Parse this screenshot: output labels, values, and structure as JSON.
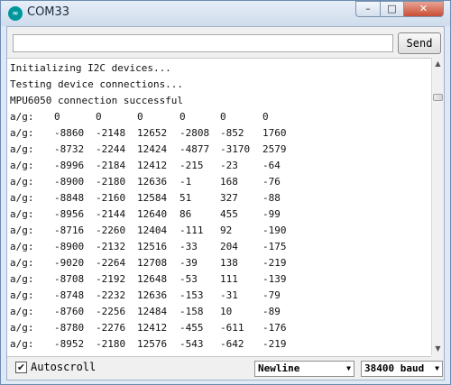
{
  "window": {
    "title": "COM33",
    "icon": "arduino-icon",
    "controls": {
      "minimize": "–",
      "maximize": "□",
      "close": "✕"
    }
  },
  "input": {
    "value": "",
    "placeholder": ""
  },
  "send_label": "Send",
  "output": {
    "messages": [
      "Initializing I2C devices...",
      "Testing device connections...",
      "MPU6050 connection successful"
    ],
    "rows": [
      {
        "label": "a/g:",
        "values": [
          "0",
          "0",
          "0",
          "0",
          "0",
          "0"
        ]
      },
      {
        "label": "a/g:",
        "values": [
          "-8860",
          "-2148",
          "12652",
          "-2808",
          "-852",
          "1760"
        ]
      },
      {
        "label": "a/g:",
        "values": [
          "-8732",
          "-2244",
          "12424",
          "-4877",
          "-3170",
          "2579"
        ]
      },
      {
        "label": "a/g:",
        "values": [
          "-8996",
          "-2184",
          "12412",
          "-215",
          "-23",
          "-64"
        ]
      },
      {
        "label": "a/g:",
        "values": [
          "-8900",
          "-2180",
          "12636",
          "-1",
          "168",
          "-76"
        ]
      },
      {
        "label": "a/g:",
        "values": [
          "-8848",
          "-2160",
          "12584",
          "51",
          "327",
          "-88"
        ]
      },
      {
        "label": "a/g:",
        "values": [
          "-8956",
          "-2144",
          "12640",
          "86",
          "455",
          "-99"
        ]
      },
      {
        "label": "a/g:",
        "values": [
          "-8716",
          "-2260",
          "12404",
          "-111",
          "92",
          "-190"
        ]
      },
      {
        "label": "a/g:",
        "values": [
          "-8900",
          "-2132",
          "12516",
          "-33",
          "204",
          "-175"
        ]
      },
      {
        "label": "a/g:",
        "values": [
          "-9020",
          "-2264",
          "12708",
          "-39",
          "138",
          "-219"
        ]
      },
      {
        "label": "a/g:",
        "values": [
          "-8708",
          "-2192",
          "12648",
          "-53",
          "111",
          "-139"
        ]
      },
      {
        "label": "a/g:",
        "values": [
          "-8748",
          "-2232",
          "12636",
          "-153",
          "-31",
          "-79"
        ]
      },
      {
        "label": "a/g:",
        "values": [
          "-8760",
          "-2256",
          "12484",
          "-158",
          "10",
          "-89"
        ]
      },
      {
        "label": "a/g:",
        "values": [
          "-8780",
          "-2276",
          "12412",
          "-455",
          "-611",
          "-176"
        ]
      },
      {
        "label": "a/g:",
        "values": [
          "-8952",
          "-2180",
          "12576",
          "-543",
          "-642",
          "-219"
        ]
      }
    ]
  },
  "autoscroll": {
    "label": "Autoscroll",
    "checked": true,
    "check_glyph": "✔"
  },
  "line_ending": {
    "selected": "Newline"
  },
  "baud": {
    "selected": "38400 baud"
  },
  "scroll_glyphs": {
    "up": "▲",
    "down": "▼"
  },
  "select_caret": "▼"
}
